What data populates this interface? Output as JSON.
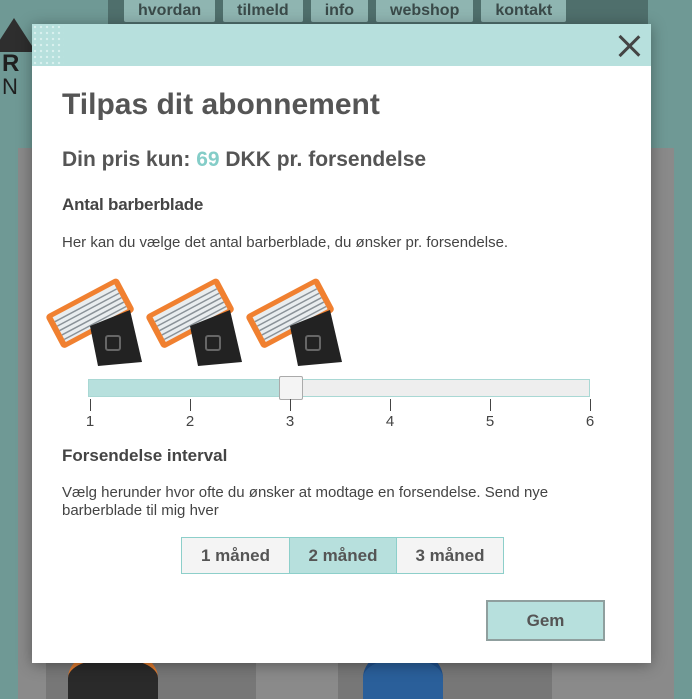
{
  "background": {
    "nav": [
      "hvordan",
      "tilmeld",
      "info",
      "webshop",
      "kontakt"
    ],
    "logo_letters": [
      "R",
      "N"
    ]
  },
  "modal": {
    "title": "Tilpas dit abonnement",
    "price": {
      "prefix": "Din pris kun: ",
      "amount": "69",
      "suffix": " DKK pr. forsendelse"
    },
    "blades": {
      "heading": "Antal barberblade",
      "description": "Her kan du vælge det antal barberblade, du ønsker pr. forsendelse.",
      "selected": 3,
      "min": 1,
      "max": 6,
      "tick_labels": [
        "1",
        "2",
        "3",
        "4",
        "5",
        "6"
      ]
    },
    "interval": {
      "heading": "Forsendelse interval",
      "description": "Vælg herunder hvor ofte du ønsker at modtage en forsendelse. Send nye barberblade til mig hver",
      "options": [
        "1 måned",
        "2 måned",
        "3 måned"
      ],
      "selected_index": 1
    },
    "save_label": "Gem"
  },
  "colors": {
    "accent": "#b7e0dd",
    "price_number": "#84cdc8",
    "blade_orange": "#f08030",
    "blade_dark": "#222222"
  },
  "icons": {
    "close": "close-icon",
    "razor": "razor-cartridge-icon"
  }
}
